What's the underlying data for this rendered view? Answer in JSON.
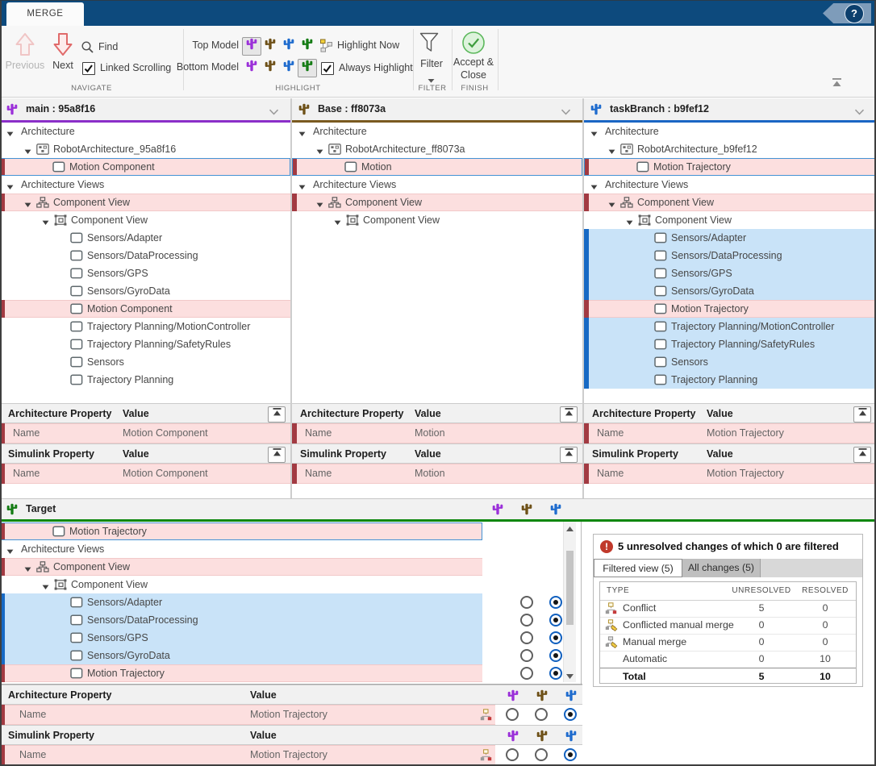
{
  "titlebar": {
    "tab": "MERGE",
    "help": "?"
  },
  "toolbar": {
    "previous": "Previous",
    "next": "Next",
    "find": "Find",
    "linked_scrolling": "Linked Scrolling",
    "top_model": "Top Model",
    "bottom_model": "Bottom Model",
    "highlight_now": "Highlight Now",
    "always_highlight": "Always Highlight",
    "filter": "Filter",
    "accept_line1": "Accept &",
    "accept_line2": "Close",
    "sections": {
      "navigate": "NAVIGATE",
      "highlight": "HIGHLIGHT",
      "filter": "FILTER",
      "finish": "FINISH"
    }
  },
  "colors": {
    "titlebar": "#0d4a7d",
    "purple": "#9b30d9",
    "brown": "#6e5118",
    "blue": "#1f6cce",
    "green": "#157c15",
    "conflict_row": "#fcdfdf",
    "conflict_bar": "#a23a42",
    "added_row": "#c9e3f8",
    "added_bar": "#1769c4",
    "selection": "#4493d4",
    "target_underline": "#0c870c"
  },
  "panels": [
    {
      "title": "main : 95a8f16",
      "accent": "#8b2fc9",
      "icon_color": "#9b30d9",
      "tree": [
        {
          "label": "Architecture",
          "lvl": 0,
          "exp": true
        },
        {
          "label": "RobotArchitecture_95a8f16",
          "lvl": 1,
          "exp": true,
          "icon": "arch"
        },
        {
          "label": "Motion Component",
          "lvl": 2,
          "icon": "comp",
          "state": "conflict",
          "sel": true
        },
        {
          "label": "Architecture Views",
          "lvl": 0,
          "exp": true
        },
        {
          "label": "Component View",
          "lvl": 1,
          "exp": true,
          "icon": "view",
          "state": "conflict"
        },
        {
          "label": "Component View",
          "lvl": 2,
          "exp": true,
          "icon": "view2"
        },
        {
          "label": "Sensors/Adapter",
          "lvl": 3,
          "icon": "comp"
        },
        {
          "label": "Sensors/DataProcessing",
          "lvl": 3,
          "icon": "comp"
        },
        {
          "label": "Sensors/GPS",
          "lvl": 3,
          "icon": "comp"
        },
        {
          "label": "Sensors/GyroData",
          "lvl": 3,
          "icon": "comp"
        },
        {
          "label": "Motion Component",
          "lvl": 3,
          "icon": "comp",
          "state": "conflict"
        },
        {
          "label": "Trajectory Planning/MotionController",
          "lvl": 3,
          "icon": "comp"
        },
        {
          "label": "Trajectory Planning/SafetyRules",
          "lvl": 3,
          "icon": "comp"
        },
        {
          "label": "Sensors",
          "lvl": 3,
          "icon": "comp"
        },
        {
          "label": "Trajectory Planning",
          "lvl": 3,
          "icon": "comp"
        }
      ],
      "props": {
        "arch_header": "Architecture Property",
        "sim_header": "Simulink Property",
        "value_header": "Value",
        "arch_row": {
          "name": "Name",
          "value": "Motion Component"
        },
        "sim_row": {
          "name": "Name",
          "value": "Motion Component"
        }
      }
    },
    {
      "title": "Base : ff8073a",
      "accent": "#7a5a20",
      "icon_color": "#6e5118",
      "tree": [
        {
          "label": "Architecture",
          "lvl": 0,
          "exp": true
        },
        {
          "label": "RobotArchitecture_ff8073a",
          "lvl": 1,
          "exp": true,
          "icon": "arch"
        },
        {
          "label": "Motion",
          "lvl": 2,
          "icon": "comp",
          "state": "conflict",
          "sel": true
        },
        {
          "label": "Architecture Views",
          "lvl": 0,
          "exp": true
        },
        {
          "label": "Component View",
          "lvl": 1,
          "exp": true,
          "icon": "view",
          "state": "conflict"
        },
        {
          "label": "Component View",
          "lvl": 2,
          "exp": true,
          "icon": "view2"
        }
      ],
      "props": {
        "arch_header": "Architecture Property",
        "sim_header": "Simulink Property",
        "value_header": "Value",
        "arch_row": {
          "name": "Name",
          "value": "Motion"
        },
        "sim_row": {
          "name": "Name",
          "value": "Motion"
        }
      }
    },
    {
      "title": "taskBranch : b9fef12",
      "accent": "#1a66c4",
      "icon_color": "#1f6cce",
      "tree": [
        {
          "label": "Architecture",
          "lvl": 0,
          "exp": true
        },
        {
          "label": "RobotArchitecture_b9fef12",
          "lvl": 1,
          "exp": true,
          "icon": "arch"
        },
        {
          "label": "Motion Trajectory",
          "lvl": 2,
          "icon": "comp",
          "state": "conflict",
          "sel": true
        },
        {
          "label": "Architecture Views",
          "lvl": 0,
          "exp": true
        },
        {
          "label": "Component View",
          "lvl": 1,
          "exp": true,
          "icon": "view",
          "state": "conflict"
        },
        {
          "label": "Component View",
          "lvl": 2,
          "exp": true,
          "icon": "view2"
        },
        {
          "label": "Sensors/Adapter",
          "lvl": 3,
          "icon": "comp",
          "state": "added"
        },
        {
          "label": "Sensors/DataProcessing",
          "lvl": 3,
          "icon": "comp",
          "state": "added"
        },
        {
          "label": "Sensors/GPS",
          "lvl": 3,
          "icon": "comp",
          "state": "added"
        },
        {
          "label": "Sensors/GyroData",
          "lvl": 3,
          "icon": "comp",
          "state": "added"
        },
        {
          "label": "Motion Trajectory",
          "lvl": 3,
          "icon": "comp",
          "state": "conflict"
        },
        {
          "label": "Trajectory Planning/MotionController",
          "lvl": 3,
          "icon": "comp",
          "state": "added"
        },
        {
          "label": "Trajectory Planning/SafetyRules",
          "lvl": 3,
          "icon": "comp",
          "state": "added"
        },
        {
          "label": "Sensors",
          "lvl": 3,
          "icon": "comp",
          "state": "added"
        },
        {
          "label": "Trajectory Planning",
          "lvl": 3,
          "icon": "comp",
          "state": "added"
        }
      ],
      "props": {
        "arch_header": "Architecture Property",
        "sim_header": "Simulink Property",
        "value_header": "Value",
        "arch_row": {
          "name": "Name",
          "value": "Motion Trajectory"
        },
        "sim_row": {
          "name": "Name",
          "value": "Motion Trajectory"
        }
      }
    }
  ],
  "target": {
    "title": "Target",
    "icon_color": "#157c15",
    "column_icon_colors": [
      "#9b30d9",
      "#6e5118",
      "#1f6cce"
    ],
    "tree": [
      {
        "label": "Motion Trajectory",
        "lvl": 2,
        "icon": "comp",
        "state": "conflict",
        "sel": true
      },
      {
        "label": "Architecture Views",
        "lvl": 0,
        "exp": true
      },
      {
        "label": "Component View",
        "lvl": 1,
        "exp": true,
        "icon": "view",
        "state": "conflict"
      },
      {
        "label": "Component View",
        "lvl": 2,
        "exp": true,
        "icon": "view2"
      },
      {
        "label": "Sensors/Adapter",
        "lvl": 3,
        "icon": "comp",
        "state": "added",
        "radios": true
      },
      {
        "label": "Sensors/DataProcessing",
        "lvl": 3,
        "icon": "comp",
        "state": "added",
        "radios": true
      },
      {
        "label": "Sensors/GPS",
        "lvl": 3,
        "icon": "comp",
        "state": "added",
        "radios": true
      },
      {
        "label": "Sensors/GyroData",
        "lvl": 3,
        "icon": "comp",
        "state": "added",
        "radios": true
      },
      {
        "label": "Motion Trajectory",
        "lvl": 3,
        "icon": "comp",
        "state": "conflict",
        "radios": true
      }
    ],
    "props": {
      "arch_header": "Architecture Property",
      "sim_header": "Simulink Property",
      "value_header": "Value",
      "arch_row": {
        "name": "Name",
        "value": "Motion Trajectory"
      },
      "sim_row": {
        "name": "Name",
        "value": "Motion Trajectory"
      }
    }
  },
  "summary": {
    "title": "5 unresolved changes of which 0 are filtered",
    "alert": "!",
    "tabs": [
      {
        "label": "Filtered view (5)",
        "active": true
      },
      {
        "label": "All changes (5)",
        "active": false
      }
    ],
    "columns": [
      "TYPE",
      "UNRESOLVED",
      "RESOLVED"
    ],
    "rows": [
      {
        "icon": "conflict",
        "label": "Conflict",
        "unresolved": "5",
        "resolved": "0"
      },
      {
        "icon": "conflict_manual",
        "label": "Conflicted manual merge",
        "unresolved": "0",
        "resolved": "0"
      },
      {
        "icon": "manual",
        "label": "Manual merge",
        "unresolved": "0",
        "resolved": "0"
      },
      {
        "icon": "",
        "label": "Automatic",
        "unresolved": "0",
        "resolved": "10"
      },
      {
        "icon": "",
        "label": "Total",
        "unresolved": "5",
        "resolved": "10",
        "total": true
      }
    ]
  }
}
